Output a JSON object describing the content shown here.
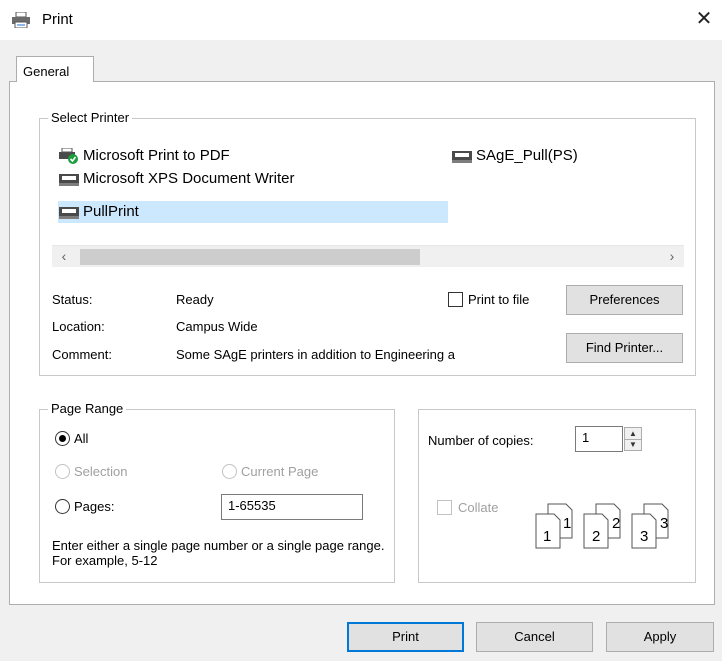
{
  "window": {
    "title": "Print",
    "close_glyph": "✕"
  },
  "tabs": [
    {
      "label": "General"
    }
  ],
  "select_printer": {
    "legend": "Select Printer",
    "printers": [
      {
        "name": "Microsoft Print to PDF",
        "icon": "printer-default-icon",
        "selected": false
      },
      {
        "name": "Microsoft XPS Document Writer",
        "icon": "printer-icon",
        "selected": false
      },
      {
        "name": "PullPrint",
        "icon": "printer-icon",
        "selected": true
      },
      {
        "name": "SAgE_Pull(PS)",
        "icon": "printer-icon",
        "selected": false
      }
    ],
    "scroll_left": "‹",
    "scroll_right": "›",
    "status_label": "Status:",
    "status_value": "Ready",
    "location_label": "Location:",
    "location_value": "Campus Wide",
    "comment_label": "Comment:",
    "comment_value": "Some SAgE printers in addition to Engineering a",
    "print_to_file_label": "Print to file",
    "print_to_file_checked": false,
    "preferences_label": "Preferences",
    "find_printer_label": "Find Printer..."
  },
  "page_range": {
    "legend": "Page Range",
    "all_label": "All",
    "all_selected": true,
    "selection_label": "Selection",
    "current_page_label": "Current Page",
    "pages_label": "Pages:",
    "pages_value": "1-65535",
    "help_text": "Enter either a single page number or a single page range.  For example, 5-12"
  },
  "copies": {
    "label": "Number of copies:",
    "value": "1",
    "collate_label": "Collate",
    "collate_checked": false,
    "page_numbers": [
      "1",
      "1",
      "2",
      "2",
      "3",
      "3"
    ]
  },
  "buttons": {
    "print": "Print",
    "cancel": "Cancel",
    "apply": "Apply"
  },
  "colors": {
    "selection": "#cce8ff",
    "default_button_border": "#0078d7",
    "scroll_thumb": "#cdcdcd"
  }
}
